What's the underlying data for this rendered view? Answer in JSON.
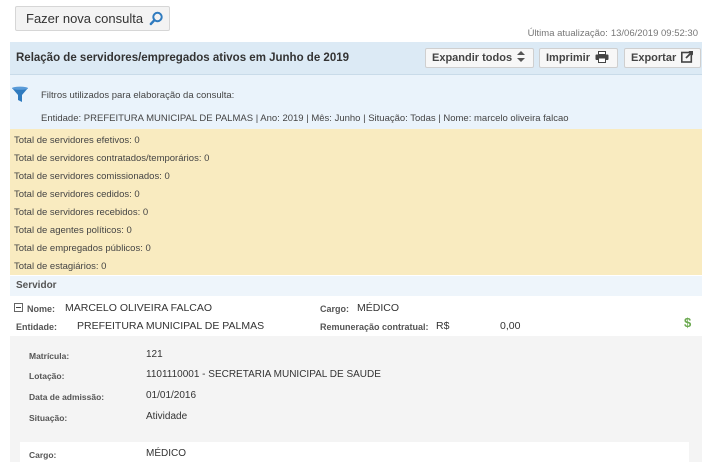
{
  "toolbar": {
    "new_query_label": "Fazer nova consulta",
    "last_update_label": "Última atualização:",
    "last_update_value": "13/06/2019 09:52:30"
  },
  "header": {
    "title": "Relação de servidores/empregados ativos em Junho de 2019",
    "expand_label": "Expandir todos",
    "print_label": "Imprimir",
    "export_label": "Exportar"
  },
  "filters": {
    "label": "Filtros utilizados para elaboração da consulta:",
    "detail": "Entidade: PREFEITURA MUNICIPAL DE PALMAS | Ano: 2019 | Mês: Junho | Situação: Todas | Nome: marcelo oliveira falcao"
  },
  "totals": [
    "Total de servidores efetivos: 0",
    "Total de servidores contratados/temporários: 0",
    "Total de servidores comissionados: 0",
    "Total de servidores cedidos: 0",
    "Total de servidores recebidos: 0",
    "Total de agentes políticos: 0",
    "Total de empregados públicos: 0",
    "Total de estagiários: 0"
  ],
  "servidor": {
    "section_label": "Servidor",
    "nome_label": "Nome:",
    "nome_value": "MARCELO OLIVEIRA FALCAO",
    "entidade_label": "Entidade:",
    "entidade_value": "PREFEITURA MUNICIPAL DE PALMAS",
    "cargo_label": "Cargo:",
    "cargo_value": "MÉDICO",
    "remuneracao_label": "Remuneração contratual:",
    "currency": "R$",
    "remuneracao_value": "0,00"
  },
  "details": {
    "matricula_label": "Matrícula:",
    "matricula_value": "121",
    "lotacao_label": "Lotação:",
    "lotacao_value": "1101110001 - SECRETARIA MUNICIPAL DE SAUDE",
    "admissao_label": "Data de admissão:",
    "admissao_value": "01/01/2016",
    "situacao_label": "Situação:",
    "situacao_value": "Atividade",
    "cargo_label": "Cargo:",
    "cargo_value": "MÉDICO"
  },
  "icons": {
    "search": "search-icon",
    "sort": "sort-icon",
    "print": "printer-icon",
    "export": "export-icon",
    "filter": "funnel-icon",
    "collapse": "minus-box-icon",
    "money": "dollar-icon"
  },
  "colors": {
    "header_bg": "#dceaf5",
    "filters_bg": "#eaf3fb",
    "totals_bg": "#f9ebc0",
    "details_bg": "#f4f4f4",
    "accent_blue": "#2f7bbf",
    "money_green": "#6aa84f"
  }
}
